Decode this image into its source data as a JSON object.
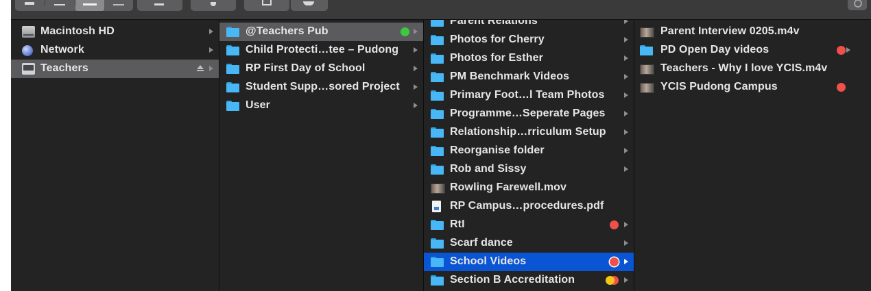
{
  "colors": {
    "sidebar_bg": "#232324",
    "selection_gray": "#5b5b5d",
    "selection_blue": "#0a55d4",
    "folder": "#48b7f5",
    "tag_red": "#f0504a",
    "tag_green": "#3cc940",
    "tag_yellow": "#f5c517",
    "text": "#e6e6e6"
  },
  "toolbar": {
    "view_buttons": [
      {
        "name": "icon-view",
        "icon": "grid-icon"
      },
      {
        "name": "list-view",
        "icon": "list-icon"
      },
      {
        "name": "column-view",
        "icon": "columns-icon",
        "selected": true
      },
      {
        "name": "gallery-view",
        "icon": "gallery-icon"
      }
    ],
    "group_button": {
      "icon": "group-icon"
    },
    "action_button": {
      "icon": "gear-icon"
    },
    "share_button": {
      "icon": "share-icon"
    },
    "tags_button": {
      "icon": "tag-icon"
    },
    "search_button": {
      "icon": "search-icon"
    }
  },
  "columns": [
    {
      "items": [
        {
          "label": "Macintosh HD",
          "icon": "hard-drive-icon",
          "disclosure": true
        },
        {
          "label": "Network",
          "icon": "network-globe-icon",
          "disclosure": true
        },
        {
          "label": "Teachers",
          "icon": "server-icon",
          "selected": "gray",
          "eject": true,
          "disclosure": true
        }
      ]
    },
    {
      "items": [
        {
          "label": "@Teachers Pub",
          "icon": "folder-icon",
          "selected": "gray",
          "tags": [
            "green"
          ],
          "disclosure": true
        },
        {
          "label": "Child Protecti…tee – Pudong",
          "icon": "folder-icon",
          "disclosure": true
        },
        {
          "label": "RP First Day of School",
          "icon": "folder-icon",
          "disclosure": true
        },
        {
          "label": "Student Supp…sored Project",
          "icon": "folder-icon",
          "disclosure": true
        },
        {
          "label": "User",
          "icon": "folder-icon",
          "disclosure": true
        }
      ]
    },
    {
      "items": [
        {
          "label": "Parent Relations",
          "icon": "folder-icon",
          "disclosure": true
        },
        {
          "label": "Photos for Cherry",
          "icon": "folder-icon",
          "disclosure": true
        },
        {
          "label": "Photos for Esther",
          "icon": "folder-icon",
          "disclosure": true
        },
        {
          "label": "PM Benchmark Videos",
          "icon": "folder-icon",
          "disclosure": true
        },
        {
          "label": "Primary Foot…l Team Photos",
          "icon": "folder-icon",
          "disclosure": true
        },
        {
          "label": "Programme…Seperate Pages",
          "icon": "folder-icon",
          "disclosure": true
        },
        {
          "label": "Relationship…rriculum Setup",
          "icon": "folder-icon",
          "disclosure": true
        },
        {
          "label": "Reorganise folder",
          "icon": "folder-icon",
          "disclosure": true
        },
        {
          "label": "Rob and Sissy",
          "icon": "folder-icon",
          "disclosure": true
        },
        {
          "label": "Rowling Farewell.mov",
          "icon": "video-file-icon",
          "disclosure": false
        },
        {
          "label": "RP Campus…procedures.pdf",
          "icon": "pdf-file-icon",
          "disclosure": false
        },
        {
          "label": "RtI",
          "icon": "folder-icon",
          "tags": [
            "red"
          ],
          "disclosure": true
        },
        {
          "label": "Scarf dance",
          "icon": "folder-icon",
          "disclosure": true
        },
        {
          "label": "School Videos",
          "icon": "folder-icon",
          "selected": "blue",
          "tags": [
            "red"
          ],
          "disclosure": true
        },
        {
          "label": "Section B Accreditation",
          "icon": "folder-icon",
          "tags": [
            "yellow",
            "red"
          ],
          "disclosure": true
        }
      ]
    },
    {
      "items": [
        {
          "label": "Parent Interview 0205.m4v",
          "icon": "video-file-icon",
          "disclosure": false
        },
        {
          "label": "PD Open Day videos",
          "icon": "folder-icon",
          "tags": [
            "red"
          ],
          "disclosure": true
        },
        {
          "label": "Teachers - Why I love YCIS.m4v",
          "icon": "video-file-icon",
          "disclosure": false
        },
        {
          "label": "YCIS Pudong Campus",
          "icon": "video-file-icon",
          "tags": [
            "red"
          ],
          "disclosure": false
        }
      ]
    }
  ]
}
